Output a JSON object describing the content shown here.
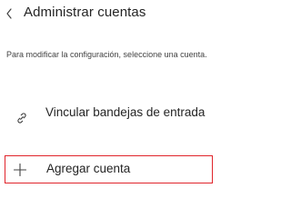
{
  "header": {
    "back_icon": "chevron-left-icon",
    "title": "Administrar cuentas"
  },
  "description": "Para modificar la configuración, seleccione una cuenta.",
  "items": [
    {
      "icon": "link-icon",
      "label": "Vincular bandejas de entrada"
    },
    {
      "icon": "plus-icon",
      "label": "Agregar cuenta",
      "highlight_color": "#e0242b"
    }
  ]
}
